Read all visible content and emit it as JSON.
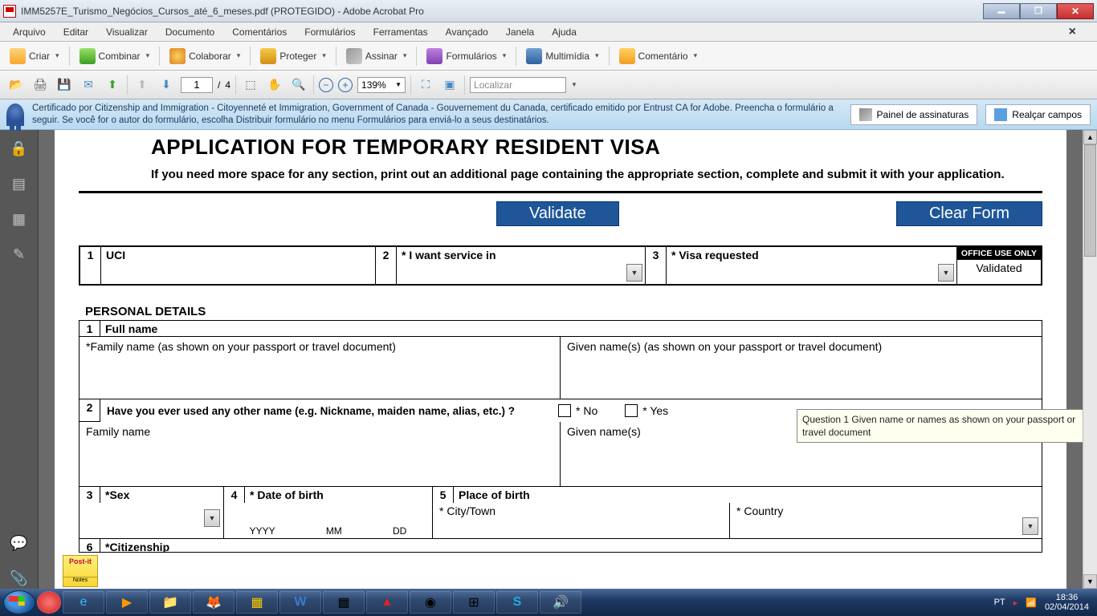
{
  "window": {
    "title": "IMM5257E_Turismo_Negócios_Cursos_até_6_meses.pdf (PROTEGIDO) - Adobe Acrobat Pro"
  },
  "menu": {
    "arquivo": "Arquivo",
    "editar": "Editar",
    "visualizar": "Visualizar",
    "documento": "Documento",
    "comentarios": "Comentários",
    "formularios": "Formulários",
    "ferramentas": "Ferramentas",
    "avancado": "Avançado",
    "janela": "Janela",
    "ajuda": "Ajuda"
  },
  "toolbar": {
    "criar": "Criar",
    "combinar": "Combinar",
    "colaborar": "Colaborar",
    "proteger": "Proteger",
    "assinar": "Assinar",
    "formularios": "Formulários",
    "multimidia": "Multimídia",
    "comentario": "Comentário"
  },
  "toolbar2": {
    "page_current": "1",
    "page_sep": "/",
    "page_total": "4",
    "zoom": "139%",
    "search_placeholder": "Localizar"
  },
  "cert": {
    "text": "Certificado por Citizenship and Immigration - Citoyenneté et Immigration, Government of Canada - Gouvernement du Canada, certificado emitido por Entrust CA for Adobe.  Preencha o formulário a seguir. Se você for o autor do formulário, escolha Distribuir formulário no menu Formulários para enviá-lo a seus destinatários.",
    "btn_panel": "Painel de assinaturas",
    "btn_highlight": "Realçar campos"
  },
  "form": {
    "title": "APPLICATION FOR TEMPORARY RESIDENT VISA",
    "subtitle": "If you need more space for any section, print out an additional page containing the appropriate section, complete and submit it with your application.",
    "btn_validate": "Validate",
    "btn_clear": "Clear Form",
    "row1": {
      "n1": "1",
      "l1": "UCI",
      "n2": "2",
      "l2": "* I want service in",
      "n3": "3",
      "l3": "* Visa requested",
      "office_head": "OFFICE USE ONLY",
      "office_val": "Validated"
    },
    "section_pd": "PERSONAL DETAILS",
    "pd": {
      "n1": "1",
      "fullname": "Full name",
      "family_lbl": "*Family name  (as shown on your passport or travel document)",
      "given_lbl": "Given name(s)  (as shown on your passport or travel document)",
      "n2": "2",
      "q2": "Have you ever used any other name (e.g. Nickname, maiden name, alias, etc.) ?",
      "no": "* No",
      "yes": "* Yes",
      "family2": "Family name",
      "given2": "Given name(s)",
      "n3": "3",
      "sex": "*Sex",
      "n4": "4",
      "dob": "* Date of birth",
      "yyyy": "YYYY",
      "mm": "MM",
      "dd": "DD",
      "n5": "5",
      "pob": "Place of birth",
      "city": "* City/Town",
      "country": "* Country",
      "n6": "6",
      "citizenship": "*Citizenship"
    },
    "tooltip": "Question 1 Given name or names as shown on your passport or travel document"
  },
  "postit": {
    "brand": "Post-it",
    "sub": "Notes"
  },
  "tray": {
    "lang": "PT",
    "time": "18:36",
    "date": "02/04/2014"
  }
}
